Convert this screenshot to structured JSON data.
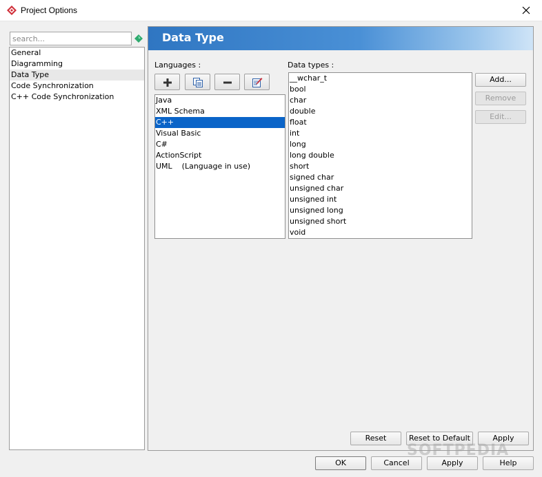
{
  "window": {
    "title": "Project Options",
    "icon": "visual-paradigm-logo-icon",
    "close_icon": "close-icon"
  },
  "search": {
    "placeholder": "search...",
    "value": "",
    "icon": "green-gem-icon"
  },
  "sidebar": {
    "items": [
      {
        "label": "General",
        "selected": false
      },
      {
        "label": "Diagramming",
        "selected": false
      },
      {
        "label": "Data Type",
        "selected": true
      },
      {
        "label": "Code Synchronization",
        "selected": false
      },
      {
        "label": "C++ Code Synchronization",
        "selected": false
      }
    ]
  },
  "panel": {
    "title": "Data Type",
    "languages_label": "Languages :",
    "datatypes_label": "Data types :",
    "toolbar": [
      {
        "icon": "plus-icon",
        "action": "add-language"
      },
      {
        "icon": "copy-icon",
        "action": "duplicate-language"
      },
      {
        "icon": "minus-icon",
        "action": "remove-language"
      },
      {
        "icon": "edit-icon",
        "action": "edit-language"
      }
    ],
    "languages": [
      "Java",
      "XML Schema",
      "C++",
      "Visual Basic",
      "C#",
      "ActionScript",
      "UML    (Language in use)"
    ],
    "selected_language": "C++",
    "data_types": [
      "__wchar_t",
      "bool",
      "char",
      "double",
      "float",
      "int",
      "long",
      "long double",
      "short",
      "signed char",
      "unsigned char",
      "unsigned int",
      "unsigned long",
      "unsigned short",
      "void"
    ],
    "buttons": {
      "add": "Add...",
      "remove": "Remove",
      "edit": "Edit..."
    },
    "footer": {
      "reset": "Reset",
      "reset_default": "Reset to Default",
      "apply": "Apply"
    }
  },
  "dialog_buttons": {
    "ok": "OK",
    "cancel": "Cancel",
    "apply": "Apply",
    "help": "Help"
  },
  "watermark": "SOFTPEDIA",
  "colors": {
    "banner": "#2f76c2",
    "selection": "#0a64c8",
    "logo": "#d0303a",
    "gem": "#2eaa6e"
  }
}
